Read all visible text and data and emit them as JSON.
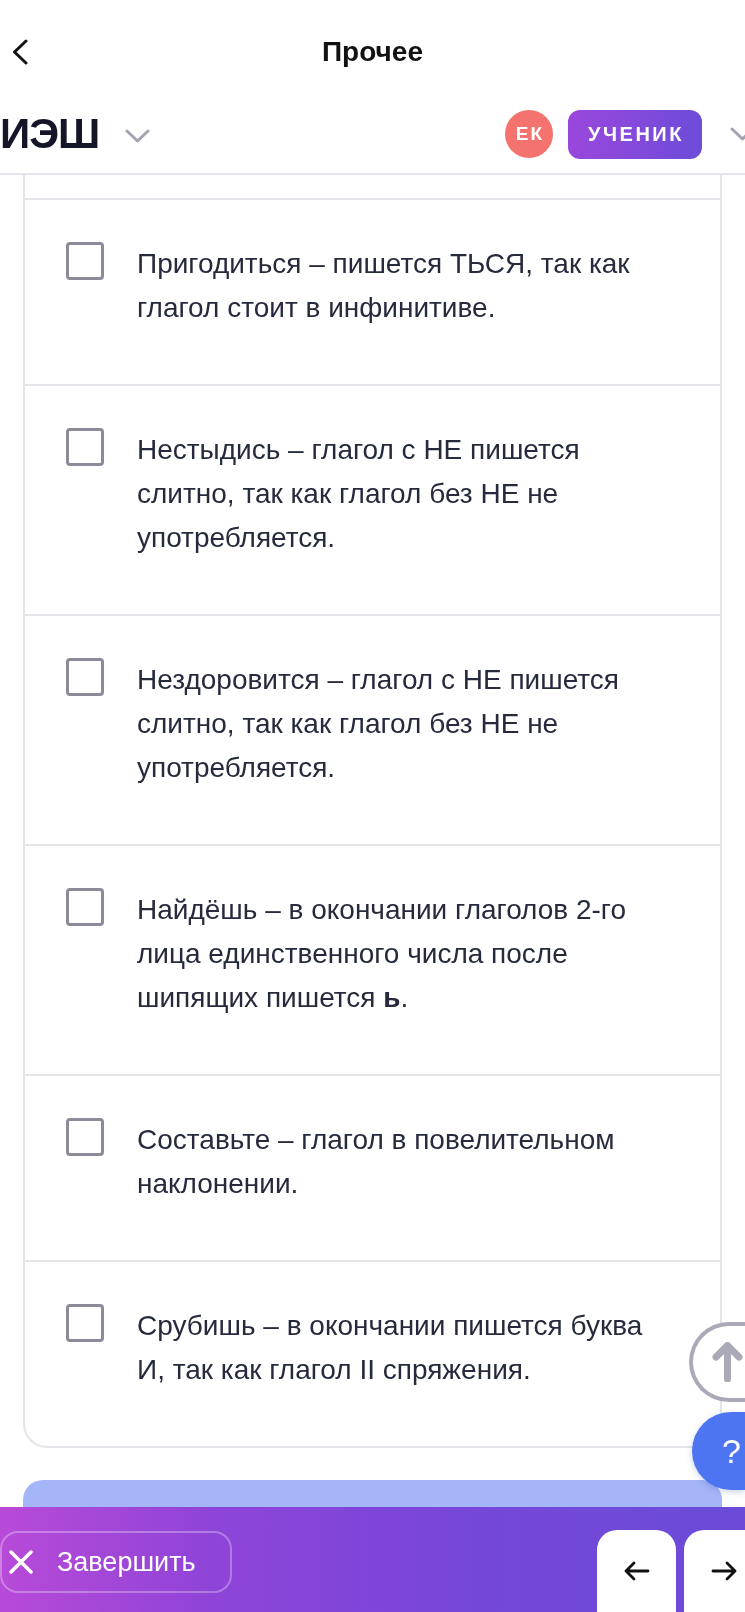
{
  "header": {
    "title": "Прочее"
  },
  "profile_bar": {
    "logo": "ИЭШ",
    "avatar_initials": "ЕК",
    "role": "УЧЕНИК"
  },
  "options": [
    {
      "text": "Пригодиться – пишется ТЬСЯ, так как глагол стоит в инфинитиве.",
      "checked": false
    },
    {
      "text": "Нестыдись – глагол с НЕ пишется слитно, так как глагол без НЕ не употребляется.",
      "checked": false
    },
    {
      "text": "Нездоровится – глагол с НЕ пишется слитно, так как глагол без НЕ не употребляется.",
      "checked": false
    },
    {
      "text": "Найдёшь – в окончании глаголов 2-го лица единственного числа после шипящих пишется **ь**.",
      "checked": false
    },
    {
      "text": "Составьте – глагол в повелительном наклонении.",
      "checked": false
    },
    {
      "text": "Срубишь – в окончании пишется буква И, так как глагол II спряжения.",
      "checked": false
    }
  ],
  "help_button": {
    "label": "?"
  },
  "bottom_bar": {
    "finish_button": "Завершить"
  }
}
